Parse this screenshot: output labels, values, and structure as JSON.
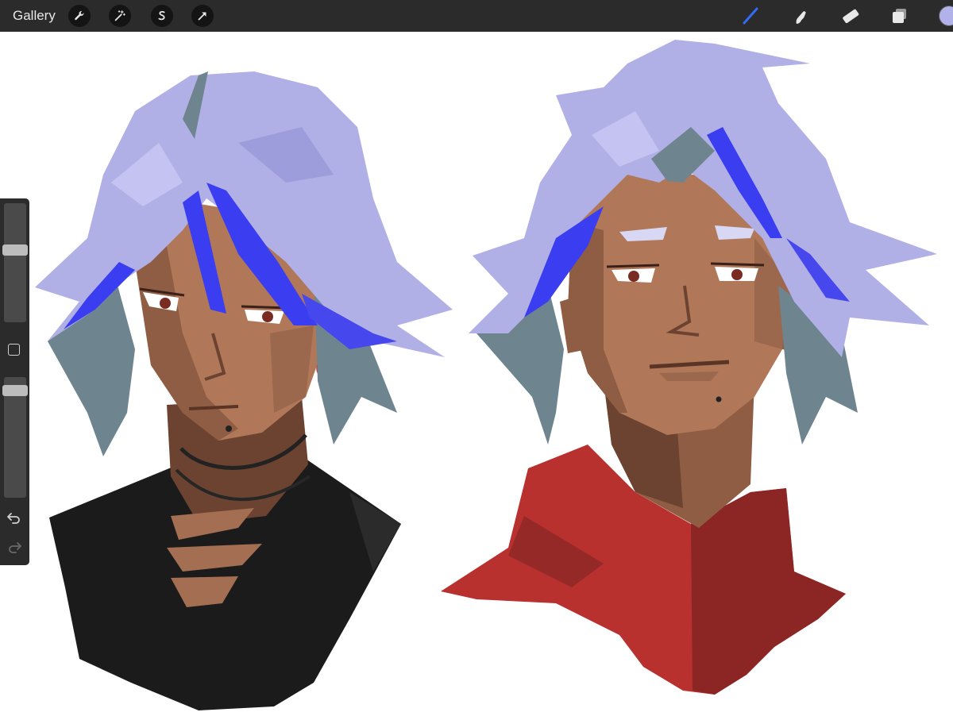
{
  "toolbar": {
    "gallery_label": "Gallery",
    "left_tools": [
      "wrench-icon",
      "magic-wand-icon",
      "selection-icon",
      "transform-arrow-icon"
    ],
    "right_tools": [
      "brush-icon",
      "smudge-icon",
      "eraser-icon",
      "layers-icon"
    ],
    "active_tool": "brush-icon",
    "current_color": "#b3b1ea",
    "accent_color": "#2f6cf5"
  },
  "sidebar": {
    "brush_size_level": 0.62,
    "opacity_level": 0.93,
    "modify_icon": "square-icon",
    "undo_icon": "undo-icon",
    "redo_icon": "redo-icon"
  },
  "artwork": {
    "hair_color": "#b1b0e6",
    "hair_shadow": "#6e8590",
    "hair_accent": "#3b3ef0",
    "skin_color": "#b07858",
    "left_shirt_color": "#1b1b1b",
    "right_collar_color": "#b8312e"
  }
}
